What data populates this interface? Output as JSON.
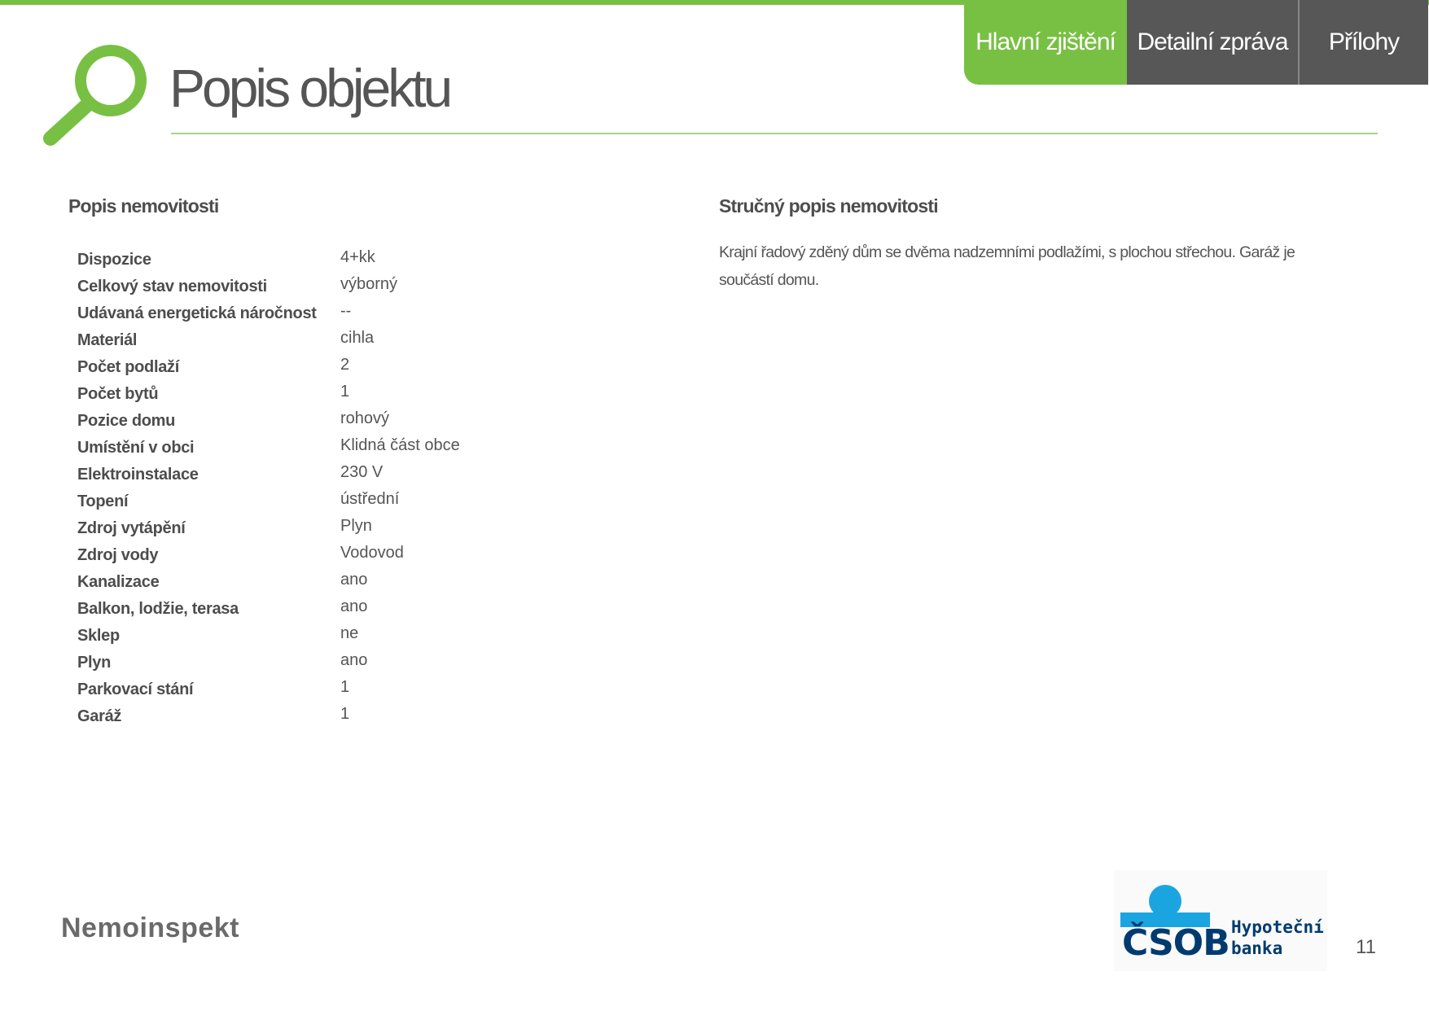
{
  "header": {
    "title": "Popis objektu",
    "tabs": [
      {
        "label": "Hlavní zjištění",
        "active": true
      },
      {
        "label": "Detailní zpráva",
        "active": false
      },
      {
        "label": "Přílohy",
        "active": false
      }
    ],
    "icon": "magnifier-icon"
  },
  "left_section": {
    "heading": "Popis nemovitosti",
    "properties": [
      {
        "label": "Dispozice",
        "value": "4+kk"
      },
      {
        "label": "Celkový stav nemovitosti",
        "value": "výborný"
      },
      {
        "label": "Udávaná energetická náročnost",
        "value": "--"
      },
      {
        "label": "Materiál",
        "value": "cihla"
      },
      {
        "label": "Počet podlaží",
        "value": "2"
      },
      {
        "label": "Počet bytů",
        "value": "1"
      },
      {
        "label": "Pozice domu",
        "value": "rohový"
      },
      {
        "label": "Umístění v obci",
        "value": "Klidná část obce"
      },
      {
        "label": "Elektroinstalace",
        "value": "230 V"
      },
      {
        "label": "Topení",
        "value": "ústřední"
      },
      {
        "label": "Zdroj vytápění",
        "value": "Plyn"
      },
      {
        "label": "Zdroj vody",
        "value": "Vodovod"
      },
      {
        "label": "Kanalizace",
        "value": "ano"
      },
      {
        "label": "Balkon, lodžie, terasa",
        "value": "ano"
      },
      {
        "label": "Sklep",
        "value": "ne"
      },
      {
        "label": "Plyn",
        "value": "ano"
      },
      {
        "label": "Parkovací stání",
        "value": "1"
      },
      {
        "label": "Garáž",
        "value": "1"
      }
    ]
  },
  "right_section": {
    "heading": "Stručný popis nemovitosti",
    "text": "Krajní řadový zděný dům se dvěma nadzemními podlažími, s plochou střechou. Garáž je součástí domu."
  },
  "footer": {
    "left_logo": "Nemoinspekt",
    "bank_logo": "ČSOB",
    "bank_sub_line1": "Hypoteční",
    "bank_sub_line2": "banka",
    "page_number": "11"
  },
  "colors": {
    "accent_green": "#78c043",
    "tab_dark": "#575757",
    "csob_blue": "#003b6f",
    "csob_light_blue": "#1aa5e0"
  }
}
